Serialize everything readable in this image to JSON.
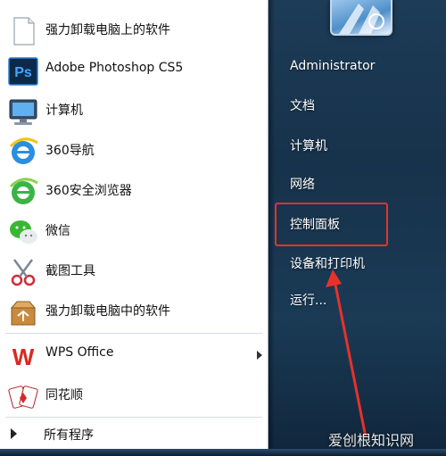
{
  "left_menu": {
    "items": [
      {
        "label": "强力卸载电脑上的软件",
        "icon": "document-icon"
      },
      {
        "label": "Adobe Photoshop CS5",
        "icon": "photoshop-icon"
      },
      {
        "label": "计算机",
        "icon": "computer-icon"
      },
      {
        "label": "360导航",
        "icon": "browser-e-icon"
      },
      {
        "label": "360安全浏览器",
        "icon": "browser-e-green-icon"
      },
      {
        "label": "微信",
        "icon": "wechat-icon"
      },
      {
        "label": "截图工具",
        "icon": "scissors-icon"
      },
      {
        "label": "强力卸载电脑中的软件",
        "icon": "uninstall-box-icon"
      },
      {
        "label": "WPS Office",
        "icon": "wps-icon",
        "has_submenu": true
      },
      {
        "label": "同花顺",
        "icon": "cards-icon"
      }
    ],
    "all_programs": "所有程序",
    "ps_icon_text": "Ps",
    "wps_icon_text": "W"
  },
  "right_menu": {
    "items": [
      {
        "label": "Administrator"
      },
      {
        "label": "文档"
      },
      {
        "label": "计算机"
      },
      {
        "label": "网络"
      },
      {
        "label": "控制面板",
        "highlighted": true
      },
      {
        "label": "设备和打印机"
      },
      {
        "label": "运行..."
      }
    ]
  },
  "annotation": {
    "highlight_color": "#e8312a"
  },
  "watermark": "爱创根知识网"
}
